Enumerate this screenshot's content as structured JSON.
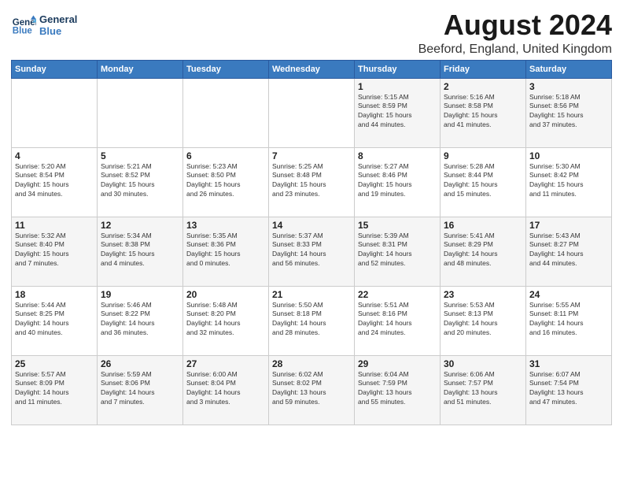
{
  "header": {
    "logo_line1": "General",
    "logo_line2": "Blue",
    "month": "August 2024",
    "location": "Beeford, England, United Kingdom"
  },
  "days_of_week": [
    "Sunday",
    "Monday",
    "Tuesday",
    "Wednesday",
    "Thursday",
    "Friday",
    "Saturday"
  ],
  "weeks": [
    [
      {
        "day": "",
        "info": ""
      },
      {
        "day": "",
        "info": ""
      },
      {
        "day": "",
        "info": ""
      },
      {
        "day": "",
        "info": ""
      },
      {
        "day": "1",
        "info": "Sunrise: 5:15 AM\nSunset: 8:59 PM\nDaylight: 15 hours\nand 44 minutes."
      },
      {
        "day": "2",
        "info": "Sunrise: 5:16 AM\nSunset: 8:58 PM\nDaylight: 15 hours\nand 41 minutes."
      },
      {
        "day": "3",
        "info": "Sunrise: 5:18 AM\nSunset: 8:56 PM\nDaylight: 15 hours\nand 37 minutes."
      }
    ],
    [
      {
        "day": "4",
        "info": "Sunrise: 5:20 AM\nSunset: 8:54 PM\nDaylight: 15 hours\nand 34 minutes."
      },
      {
        "day": "5",
        "info": "Sunrise: 5:21 AM\nSunset: 8:52 PM\nDaylight: 15 hours\nand 30 minutes."
      },
      {
        "day": "6",
        "info": "Sunrise: 5:23 AM\nSunset: 8:50 PM\nDaylight: 15 hours\nand 26 minutes."
      },
      {
        "day": "7",
        "info": "Sunrise: 5:25 AM\nSunset: 8:48 PM\nDaylight: 15 hours\nand 23 minutes."
      },
      {
        "day": "8",
        "info": "Sunrise: 5:27 AM\nSunset: 8:46 PM\nDaylight: 15 hours\nand 19 minutes."
      },
      {
        "day": "9",
        "info": "Sunrise: 5:28 AM\nSunset: 8:44 PM\nDaylight: 15 hours\nand 15 minutes."
      },
      {
        "day": "10",
        "info": "Sunrise: 5:30 AM\nSunset: 8:42 PM\nDaylight: 15 hours\nand 11 minutes."
      }
    ],
    [
      {
        "day": "11",
        "info": "Sunrise: 5:32 AM\nSunset: 8:40 PM\nDaylight: 15 hours\nand 7 minutes."
      },
      {
        "day": "12",
        "info": "Sunrise: 5:34 AM\nSunset: 8:38 PM\nDaylight: 15 hours\nand 4 minutes."
      },
      {
        "day": "13",
        "info": "Sunrise: 5:35 AM\nSunset: 8:36 PM\nDaylight: 15 hours\nand 0 minutes."
      },
      {
        "day": "14",
        "info": "Sunrise: 5:37 AM\nSunset: 8:33 PM\nDaylight: 14 hours\nand 56 minutes."
      },
      {
        "day": "15",
        "info": "Sunrise: 5:39 AM\nSunset: 8:31 PM\nDaylight: 14 hours\nand 52 minutes."
      },
      {
        "day": "16",
        "info": "Sunrise: 5:41 AM\nSunset: 8:29 PM\nDaylight: 14 hours\nand 48 minutes."
      },
      {
        "day": "17",
        "info": "Sunrise: 5:43 AM\nSunset: 8:27 PM\nDaylight: 14 hours\nand 44 minutes."
      }
    ],
    [
      {
        "day": "18",
        "info": "Sunrise: 5:44 AM\nSunset: 8:25 PM\nDaylight: 14 hours\nand 40 minutes."
      },
      {
        "day": "19",
        "info": "Sunrise: 5:46 AM\nSunset: 8:22 PM\nDaylight: 14 hours\nand 36 minutes."
      },
      {
        "day": "20",
        "info": "Sunrise: 5:48 AM\nSunset: 8:20 PM\nDaylight: 14 hours\nand 32 minutes."
      },
      {
        "day": "21",
        "info": "Sunrise: 5:50 AM\nSunset: 8:18 PM\nDaylight: 14 hours\nand 28 minutes."
      },
      {
        "day": "22",
        "info": "Sunrise: 5:51 AM\nSunset: 8:16 PM\nDaylight: 14 hours\nand 24 minutes."
      },
      {
        "day": "23",
        "info": "Sunrise: 5:53 AM\nSunset: 8:13 PM\nDaylight: 14 hours\nand 20 minutes."
      },
      {
        "day": "24",
        "info": "Sunrise: 5:55 AM\nSunset: 8:11 PM\nDaylight: 14 hours\nand 16 minutes."
      }
    ],
    [
      {
        "day": "25",
        "info": "Sunrise: 5:57 AM\nSunset: 8:09 PM\nDaylight: 14 hours\nand 11 minutes."
      },
      {
        "day": "26",
        "info": "Sunrise: 5:59 AM\nSunset: 8:06 PM\nDaylight: 14 hours\nand 7 minutes."
      },
      {
        "day": "27",
        "info": "Sunrise: 6:00 AM\nSunset: 8:04 PM\nDaylight: 14 hours\nand 3 minutes."
      },
      {
        "day": "28",
        "info": "Sunrise: 6:02 AM\nSunset: 8:02 PM\nDaylight: 13 hours\nand 59 minutes."
      },
      {
        "day": "29",
        "info": "Sunrise: 6:04 AM\nSunset: 7:59 PM\nDaylight: 13 hours\nand 55 minutes."
      },
      {
        "day": "30",
        "info": "Sunrise: 6:06 AM\nSunset: 7:57 PM\nDaylight: 13 hours\nand 51 minutes."
      },
      {
        "day": "31",
        "info": "Sunrise: 6:07 AM\nSunset: 7:54 PM\nDaylight: 13 hours\nand 47 minutes."
      }
    ]
  ]
}
